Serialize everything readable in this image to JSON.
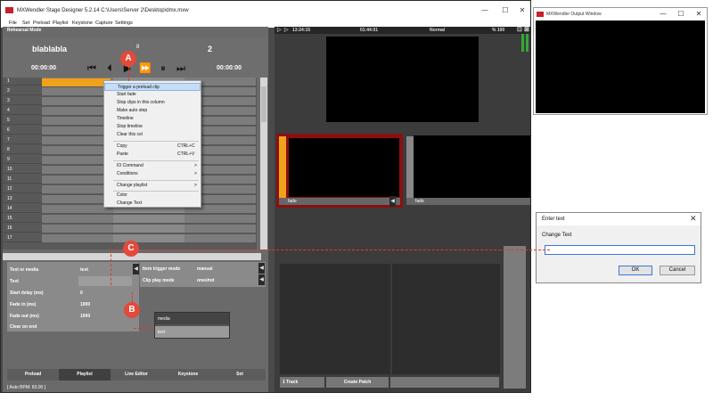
{
  "app": {
    "title": "MXWendler Stage Designer 5.2.14  C:\\Users\\Server 2\\Desktop\\dmx.mxw",
    "menu": [
      "File",
      "Set",
      "Preload",
      "Playlist",
      "Keystone",
      "Capture",
      "Settings"
    ],
    "win_controls": [
      "—",
      "☐",
      "✕"
    ]
  },
  "left": {
    "mode": "Rehearsal Mode",
    "clip_name": "blablabla",
    "clip_index": "8",
    "clip_number": "2",
    "time_left": "00:00:00",
    "time_right": "00:00:00",
    "transport": [
      "⏮",
      "⏴",
      "▶",
      "⏩",
      "⏸",
      "⏭"
    ],
    "rows": [
      "1",
      "2",
      "3",
      "4",
      "5",
      "6",
      "7",
      "8",
      "9",
      "10",
      "11",
      "12",
      "13",
      "14",
      "15",
      "16",
      "17"
    ]
  },
  "context_menu": {
    "items": [
      {
        "label": "Trigger a preload clip",
        "shortcut": "",
        "arrow": ""
      },
      {
        "label": "Start fade",
        "shortcut": "",
        "arrow": ""
      },
      {
        "label": "Stop clips in this column",
        "shortcut": "",
        "arrow": ""
      },
      {
        "label": "Make auto step",
        "shortcut": "",
        "arrow": ""
      },
      {
        "label": "Timeline",
        "shortcut": "",
        "arrow": ""
      },
      {
        "label": "Stop timeline",
        "shortcut": "",
        "arrow": ""
      },
      {
        "label": "Clear this cel",
        "shortcut": "",
        "arrow": ""
      },
      {
        "label": "Copy",
        "shortcut": "CTRL+C",
        "arrow": ""
      },
      {
        "label": "Paste",
        "shortcut": "CTRL+V",
        "arrow": ""
      },
      {
        "label": "IO Command",
        "shortcut": "",
        "arrow": ">"
      },
      {
        "label": "Conditions",
        "shortcut": "",
        "arrow": ">"
      },
      {
        "label": "Change playlist",
        "shortcut": "",
        "arrow": ">"
      },
      {
        "label": "Color",
        "shortcut": "",
        "arrow": ""
      },
      {
        "label": "Change Text",
        "shortcut": "",
        "arrow": ""
      }
    ]
  },
  "props": {
    "rows": [
      {
        "label": "Text or media",
        "value": "text"
      },
      {
        "label": "Text",
        "value": ""
      },
      {
        "label": "Start delay (ms)",
        "value": "0"
      },
      {
        "label": "Fade in (ms)",
        "value": "1000"
      },
      {
        "label": "Fade out (ms)",
        "value": "1000"
      },
      {
        "label": "Clear on end",
        "value": ""
      }
    ],
    "right_rows": [
      {
        "label": "Item trigger mode",
        "value": "manual"
      },
      {
        "label": "Clip play mode",
        "value": "oneshot"
      }
    ],
    "dropdown": [
      "media",
      "text"
    ]
  },
  "tabs": [
    "Preload",
    "Playlist",
    "Live Editor",
    "Keystone",
    "Set"
  ],
  "bpm": "[ Auto BPM: 60.00 ]",
  "right": {
    "time_left": "13:24:15",
    "time_center": "01:44:01",
    "mode": "Normal",
    "percent": "% 100",
    "slot1_label": "fade",
    "slot2_label": "fade",
    "track_label": "1 Track",
    "patch_label": "Create Patch"
  },
  "output_window": {
    "title": "MXWendler Output Window"
  },
  "dialog": {
    "title": "Enter text",
    "label": "Change Text",
    "value": "",
    "ok": "OK",
    "cancel": "Cancel"
  },
  "annotations": {
    "a": "A",
    "b": "B",
    "c": "C"
  },
  "colors": {
    "accent_orange": "#f2a11b",
    "badge_red": "#e24a3b",
    "selected_slot": "#8a1010"
  }
}
